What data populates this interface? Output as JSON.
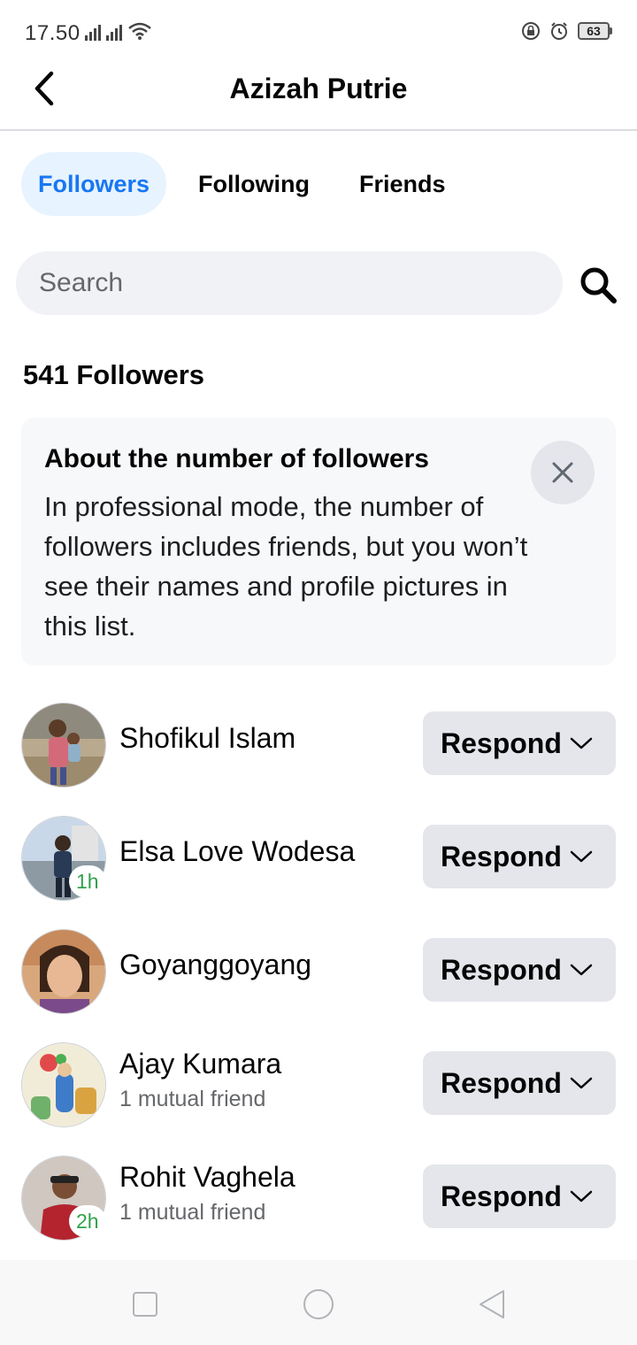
{
  "status_bar": {
    "time": "17.50",
    "battery": "63",
    "icons": [
      "signal-icon",
      "signal-icon",
      "wifi-icon",
      "lock-rotation-icon",
      "alarm-icon",
      "battery-icon"
    ]
  },
  "header": {
    "title": "Azizah Putrie",
    "back_icon": "chevron-left-icon"
  },
  "tabs": [
    {
      "label": "Followers",
      "active": true
    },
    {
      "label": "Following",
      "active": false
    },
    {
      "label": "Friends",
      "active": false
    }
  ],
  "search": {
    "placeholder": "Search",
    "value": "",
    "icon": "search-icon"
  },
  "followers_count": "541 Followers",
  "info_card": {
    "title": "About the number of followers",
    "body": "In professional mode, the number of followers includes friends, but you won’t see their names and profile pictures in this list.",
    "close_icon": "close-icon"
  },
  "followers": [
    {
      "name": "Shofikul Islam",
      "subtitle": "",
      "badge": "",
      "button": "Respond"
    },
    {
      "name": "Elsa Love Wodesa",
      "subtitle": "",
      "badge": "1h",
      "button": "Respond"
    },
    {
      "name": "Goyanggoyang",
      "subtitle": "",
      "badge": "",
      "button": "Respond"
    },
    {
      "name": "Ajay Kumara",
      "subtitle": "1 mutual friend",
      "badge": "",
      "button": "Respond"
    },
    {
      "name": "Rohit Vaghela",
      "subtitle": "1 mutual friend",
      "badge": "2h",
      "button": "Respond"
    }
  ],
  "nav_bar": {
    "icons": [
      "recents-square-icon",
      "home-circle-icon",
      "back-triangle-icon"
    ]
  },
  "colors": {
    "accent": "#1877f2",
    "active_tab_bg": "#e7f3ff",
    "button_bg": "#e4e6eb",
    "online_badge": "#31a24c"
  }
}
